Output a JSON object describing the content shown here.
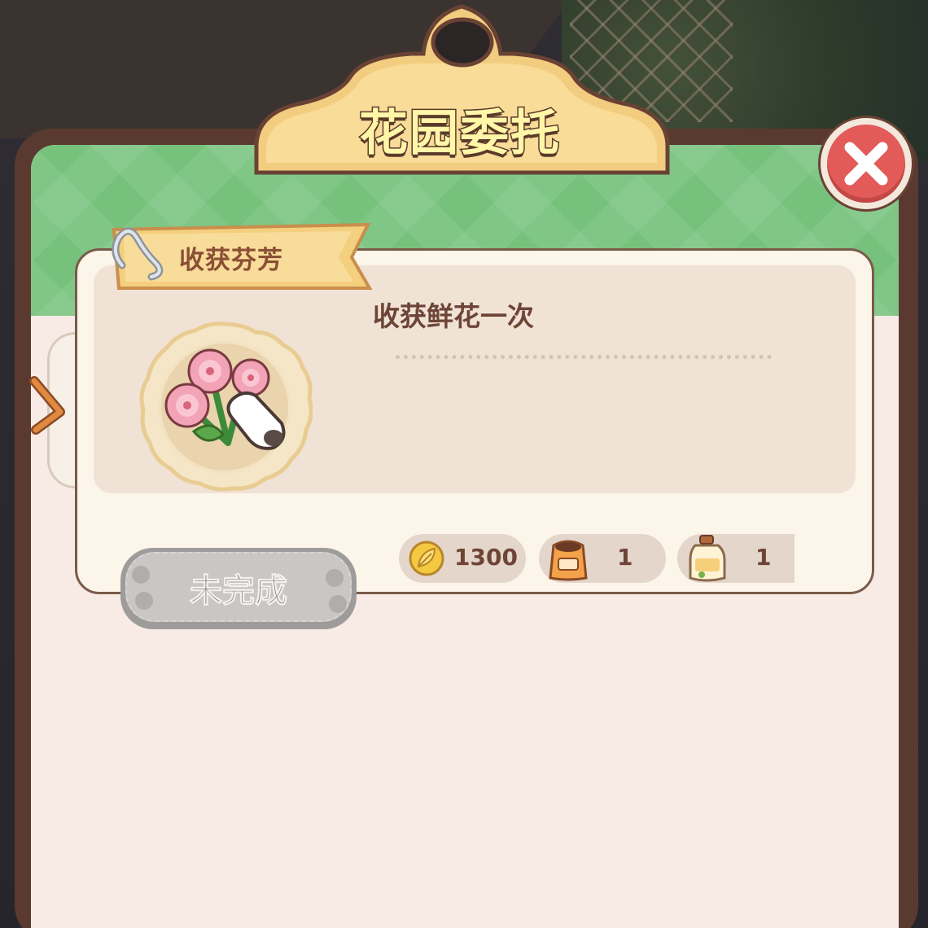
{
  "header": {
    "title": "花园委托"
  },
  "close": {
    "icon": "close-icon"
  },
  "task": {
    "category": "收获芬芳",
    "description": "收获鲜花一次",
    "status": "未完成"
  },
  "rewards": [
    {
      "icon": "leaf-coin-icon",
      "amount": "1300"
    },
    {
      "icon": "seed-bag-icon",
      "amount": "1"
    },
    {
      "icon": "fertilizer-bottle-icon",
      "amount": "1"
    }
  ],
  "colors": {
    "accent_green": "#76c27c",
    "title_fill": "#fff6a8",
    "close_red": "#e25b58",
    "text_brown": "#6d4536"
  }
}
